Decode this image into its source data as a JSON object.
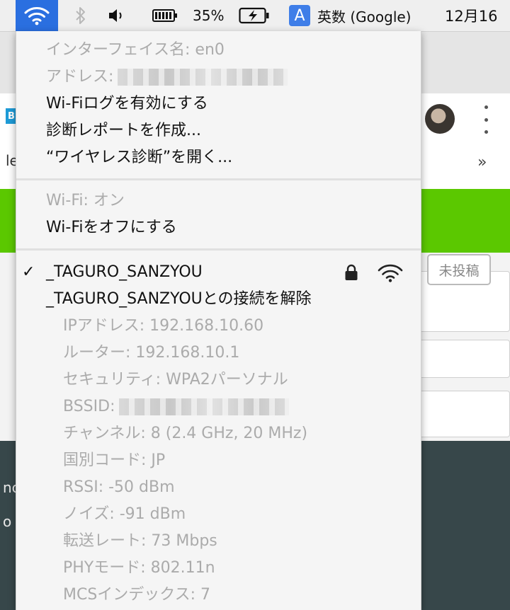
{
  "menubar": {
    "battery_percent": "35%",
    "input_source_badge": "A",
    "input_source_label": "英数 (Google)",
    "clock": "12月16"
  },
  "background": {
    "fragment_1": "le",
    "fragment_2": "»",
    "fragment_3": "nc",
    "fragment_4": "o",
    "logo_letter": "B",
    "draft_button": "未投稿"
  },
  "wifi_menu": {
    "interface_name": "インターフェイス名: en0",
    "address_label": "アドレス:",
    "enable_logging": "Wi-Fiログを有効にする",
    "create_diagnostics": "診断レポートを作成...",
    "open_wireless_diagnostics": "“ワイヤレス診断”を開く...",
    "wifi_status": "Wi-Fi: オン",
    "turn_wifi_off": "Wi-Fiをオフにする",
    "checkmark": "✓",
    "network_name": "_TAGURO_SANZYOU",
    "disconnect": "_TAGURO_SANZYOUとの接続を解除",
    "details": {
      "ip": "IPアドレス: 192.168.10.60",
      "router": "ルーター: 192.168.10.1",
      "security": "セキュリティ: WPA2パーソナル",
      "bssid_label": "BSSID:",
      "channel": "チャンネル: 8 (2.4 GHz, 20 MHz)",
      "country": "国別コード: JP",
      "rssi": "RSSI: -50 dBm",
      "noise": "ノイズ: -91 dBm",
      "tx_rate": "転送レート: 73 Mbps",
      "phy_mode": "PHYモード: 802.11n",
      "mcs_index": "MCSインデックス: 7"
    }
  },
  "colors": {
    "menubar_highlight": "#2a6fe0",
    "menu_background": "#f5f5f5",
    "disabled_text": "#ababab",
    "page_green": "#5bc800",
    "page_dark": "#37474a"
  },
  "icons": [
    "wifi-icon",
    "bluetooth-icon",
    "volume-icon",
    "battery-icon",
    "battery-charging-icon",
    "lock-icon",
    "wifi-signal-icon",
    "kebab-menu-icon"
  ]
}
